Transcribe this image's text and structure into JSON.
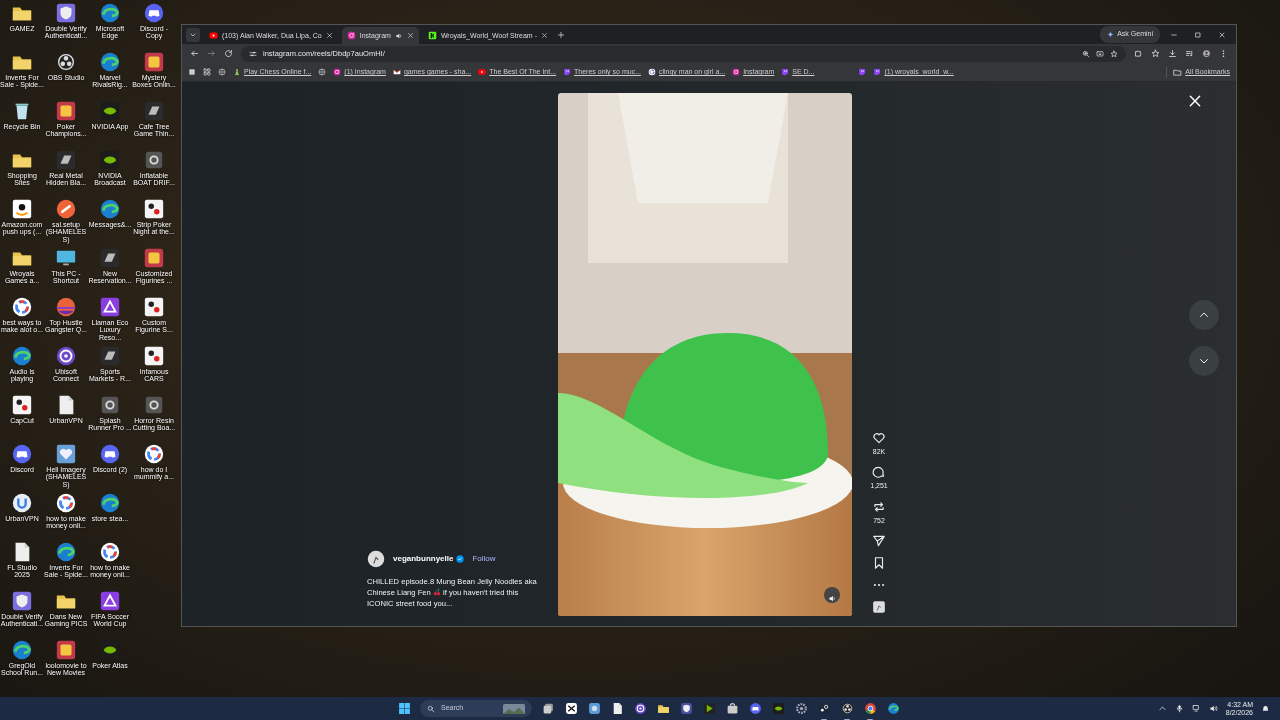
{
  "desktop_icons": [
    [
      {
        "label": "GAMEZ",
        "kind": "folder"
      },
      {
        "label": "Double Verify Authenticati...",
        "kind": "shield"
      },
      {
        "label": "Microsoft Edge",
        "kind": "edge"
      },
      {
        "label": "Discord - Copy",
        "kind": "discord"
      }
    ],
    [
      {
        "label": "Inverts For Sale - Spide...",
        "kind": "folder"
      },
      {
        "label": "OBS Studio",
        "kind": "obs"
      },
      {
        "label": "Marvel RivalsRig...",
        "kind": "edge"
      },
      {
        "label": "Mystery Boxes Onlin...",
        "kind": "game"
      }
    ],
    [
      {
        "label": "Recycle Bin",
        "kind": "recycle"
      },
      {
        "label": "Poker Champions...",
        "kind": "game"
      },
      {
        "label": "NVIDIA App",
        "kind": "nvidia"
      },
      {
        "label": "Cafe Tree Game Thin...",
        "kind": "dark"
      }
    ],
    [
      {
        "label": "Shopping Sites",
        "kind": "folder"
      },
      {
        "label": "Real Metal Hidden Bla...",
        "kind": "dark"
      },
      {
        "label": "NVIDIA Broadcast",
        "kind": "nvidia"
      },
      {
        "label": "Inflatable BOAT DRIF...",
        "kind": "letter"
      }
    ],
    [
      {
        "label": "Amazon.com push ups (...",
        "kind": "amazon"
      },
      {
        "label": "sal.setup (SHAMELESS)",
        "kind": "orange"
      },
      {
        "label": "Messages&...",
        "kind": "edge"
      },
      {
        "label": "Strip Poker Night at the...",
        "kind": "cards"
      }
    ],
    [
      {
        "label": "Wroyals Games a...",
        "kind": "folder"
      },
      {
        "label": "This PC - Shortcut",
        "kind": "pc"
      },
      {
        "label": "New Reservation...",
        "kind": "dark"
      },
      {
        "label": "Customized Figurines ...",
        "kind": "game"
      }
    ],
    [
      {
        "label": "best ways to make alot o...",
        "kind": "google"
      },
      {
        "label": "Top Hustle Gangster Q...",
        "kind": "sunset"
      },
      {
        "label": "Llaman Eco Luxury Reso...",
        "kind": "purple"
      },
      {
        "label": "Custom Figurine S...",
        "kind": "cards"
      }
    ],
    [
      {
        "label": "Audio is playing",
        "kind": "edge"
      },
      {
        "label": "Ubisoft Connect",
        "kind": "ubisoft"
      },
      {
        "label": "Sports Markets - R...",
        "kind": "dark"
      },
      {
        "label": "Infamous CARS",
        "kind": "cards"
      }
    ],
    [
      {
        "label": "CapCut",
        "kind": "cards"
      },
      {
        "label": "UrbanVPN",
        "kind": "file"
      },
      {
        "label": "Splash Runner Pro ...",
        "kind": "letter"
      },
      {
        "label": "Horror Resin Cutting Boa...",
        "kind": "letter"
      }
    ],
    [
      {
        "label": "Discord",
        "kind": "discord"
      },
      {
        "label": "Hell Imagery (SHAMELESS)",
        "kind": "heart"
      },
      {
        "label": "Discord (2)",
        "kind": "discord"
      },
      {
        "label": "how do I mummify a...",
        "kind": "google"
      }
    ],
    [
      {
        "label": "UrbanVPN",
        "kind": "vpn"
      },
      {
        "label": "how to make money onli...",
        "kind": "google"
      },
      {
        "label": "store stea...",
        "kind": "edge"
      }
    ],
    [
      {
        "label": "FL Studio 2025",
        "kind": "file"
      },
      {
        "label": "Inverts For Sale - Spide...",
        "kind": "edge"
      },
      {
        "label": "how to make money onli...",
        "kind": "google"
      }
    ],
    [
      {
        "label": "Double Verify Authenticati...",
        "kind": "shield"
      },
      {
        "label": "Dans New Gaming PICS",
        "kind": "folder"
      },
      {
        "label": "FIFA Soccer World Cup",
        "kind": "purple"
      }
    ],
    [
      {
        "label": "GregOld School Run...",
        "kind": "edge"
      },
      {
        "label": "loolomovie to New Movies",
        "kind": "game"
      },
      {
        "label": "Poker Atlas",
        "kind": "nvidia"
      }
    ]
  ],
  "browser": {
    "tabs": [
      {
        "title": "(103) Alan Walker, Dua Lipa, Co",
        "kind": "youtube",
        "selected": false,
        "audio": false
      },
      {
        "title": "Instagram",
        "kind": "instagram",
        "selected": true,
        "audio": true
      },
      {
        "title": "Wroyals_World_Woof Stream -",
        "kind": "kick",
        "selected": false,
        "audio": false
      }
    ],
    "ask_button": "Ask Gemini",
    "address": "instagram.com/reels/Dbdp7auOmHI/",
    "bookmarks": [
      {
        "kind": "globe"
      },
      {
        "kind": "chess",
        "label": "Play Chess Online f..."
      },
      {
        "kind": "globe"
      },
      {
        "kind": "instagram",
        "label": "(1) Instagram"
      },
      {
        "kind": "gmail",
        "label": "games games - sha..."
      },
      {
        "kind": "youtube",
        "label": "The Best Of The Int..."
      },
      {
        "kind": "twitch",
        "label": "Theres only so muc..."
      },
      {
        "kind": "google",
        "label": "clingy man on girl a..."
      },
      {
        "kind": "instagram",
        "label": "Instagram"
      },
      {
        "kind": "twitch",
        "label": "SE D..."
      },
      {
        "kind": "twitch"
      },
      {
        "kind": "twitch",
        "label": "(1) wroyals_world_w..."
      }
    ],
    "all_bookmarks": "All Bookmarks"
  },
  "reel": {
    "author": "veganbunnyelle",
    "verified": true,
    "follow": "Follow",
    "caption_before": "CHILLED episode.8 Mung Bean Jelly Noodles aka Chinese Liang Fen",
    "caption_after": "if you haven't tried this ICONIC street food you...",
    "likes": "82K",
    "comments": "1,251",
    "reposts": "752"
  },
  "taskbar": {
    "search_placeholder": "Search",
    "apps": [
      {
        "kind": "taskview",
        "running": false
      },
      {
        "kind": "capcut",
        "running": false
      },
      {
        "kind": "photos",
        "running": false
      },
      {
        "kind": "file",
        "running": false
      },
      {
        "kind": "ubisoft",
        "running": false
      },
      {
        "kind": "folder",
        "running": false
      },
      {
        "kind": "vpn",
        "running": false
      },
      {
        "kind": "broadcast",
        "running": false
      },
      {
        "kind": "store",
        "running": false
      },
      {
        "kind": "discord",
        "running": false
      },
      {
        "kind": "nvidia",
        "running": false
      },
      {
        "kind": "settings",
        "running": false
      },
      {
        "kind": "steam",
        "running": true
      },
      {
        "kind": "obs",
        "running": true
      },
      {
        "kind": "chrome",
        "running": true
      },
      {
        "kind": "edge",
        "running": false
      }
    ],
    "time": "4:32 AM",
    "date": "8/2/2026"
  }
}
